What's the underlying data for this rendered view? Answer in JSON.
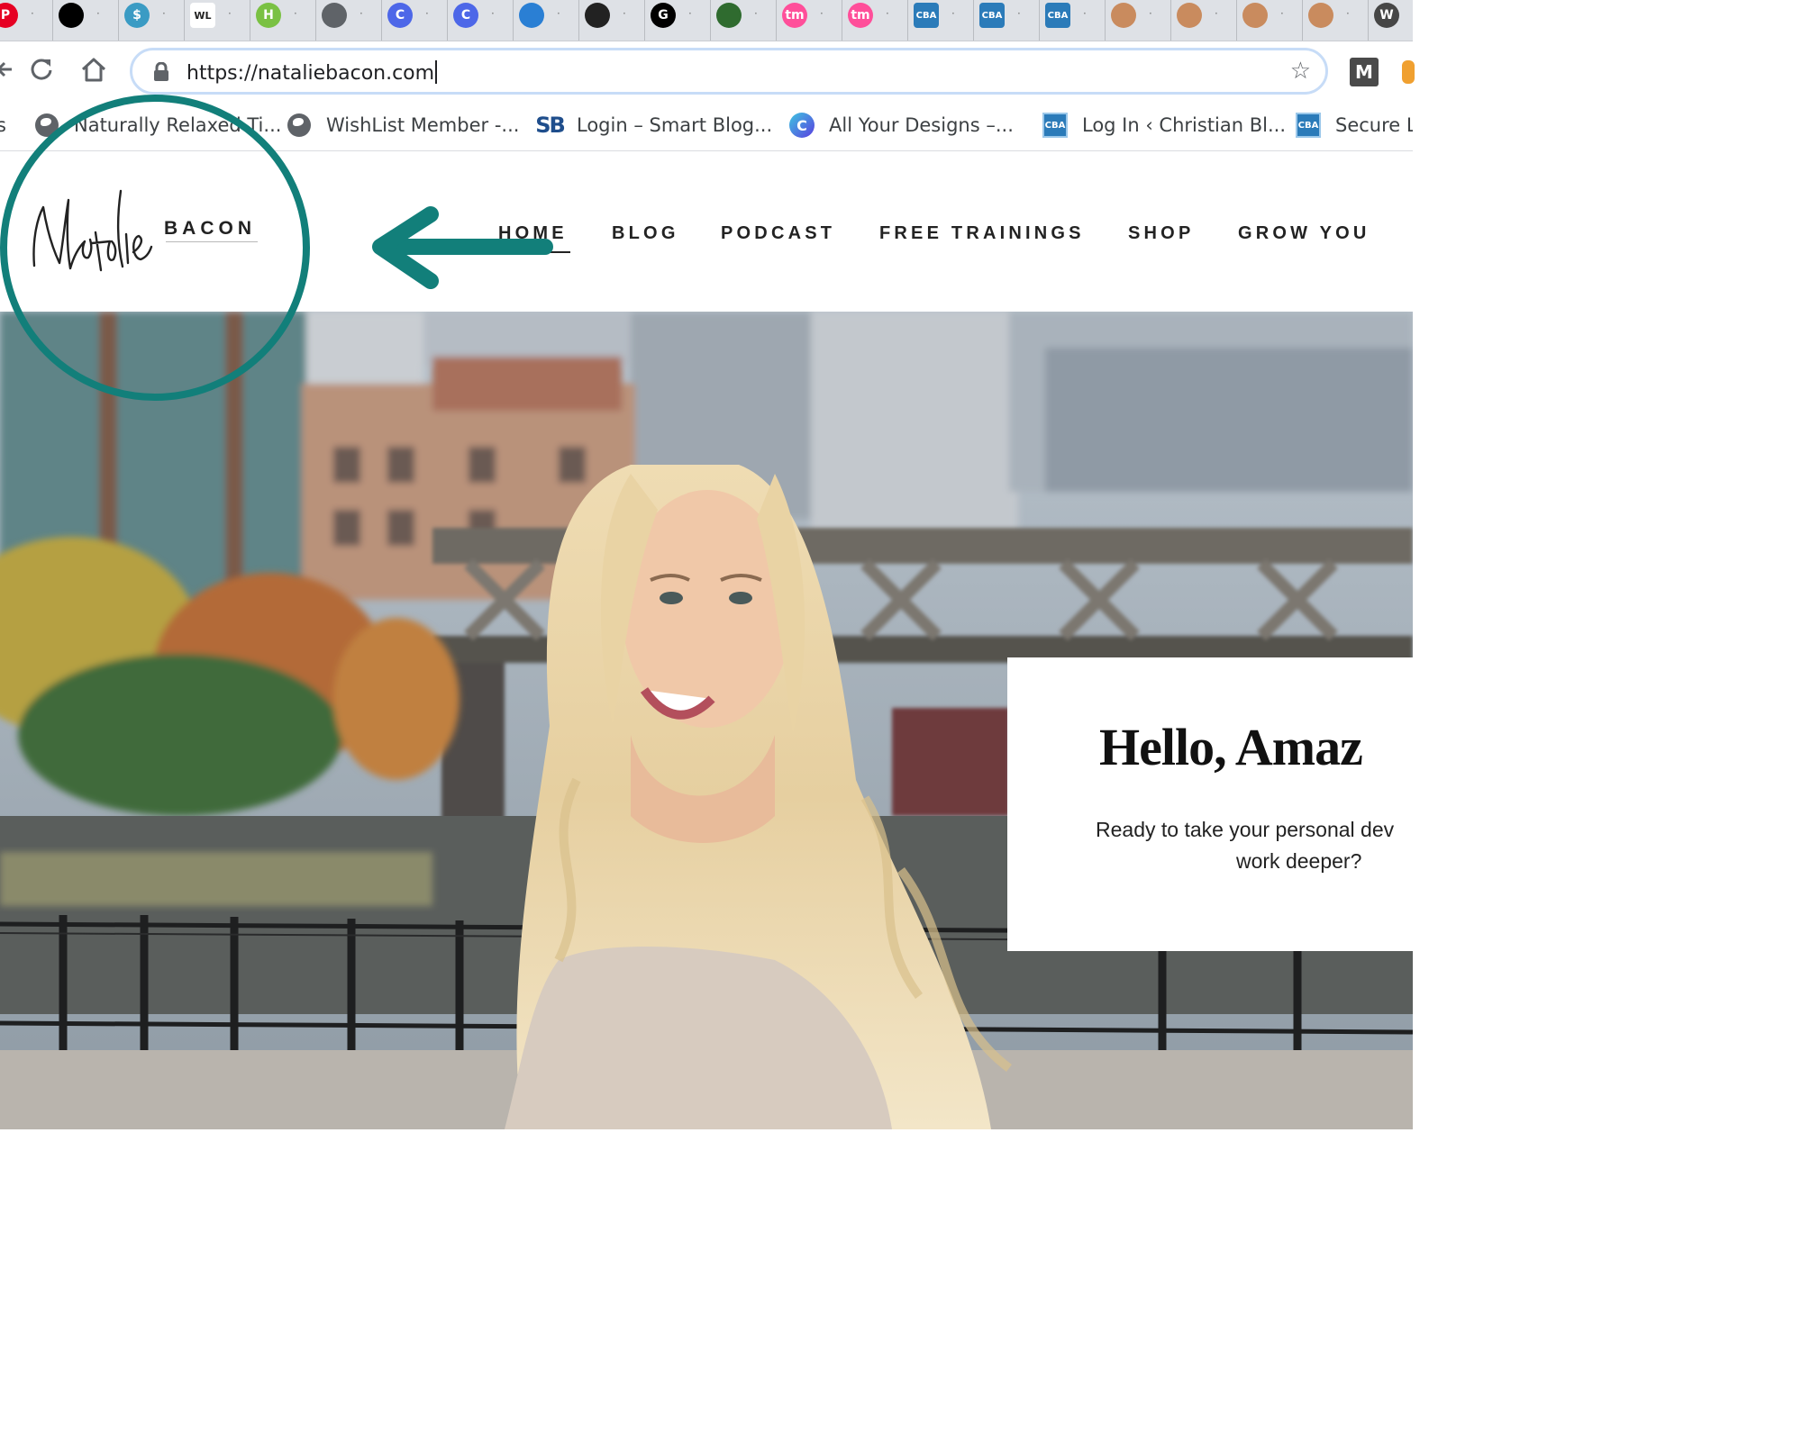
{
  "browser": {
    "tabs": [
      {
        "icon": "pinterest-icon",
        "color": "#e60023",
        "glyph": "P"
      },
      {
        "icon": "black-circle-icon",
        "color": "#000000",
        "glyph": ""
      },
      {
        "icon": "dollar-icon",
        "color": "#3a9bc4",
        "glyph": "$"
      },
      {
        "icon": "wl-icon",
        "color": "#ffffff",
        "glyph": "WL"
      },
      {
        "icon": "green-h-icon",
        "color": "#7ac143",
        "glyph": "H"
      },
      {
        "icon": "globe-icon",
        "color": "#5f6368",
        "glyph": ""
      },
      {
        "icon": "canva-icon",
        "color": "#4d67e8",
        "glyph": "C"
      },
      {
        "icon": "canva-icon",
        "color": "#4d67e8",
        "glyph": "C"
      },
      {
        "icon": "sail-icon",
        "color": "#2a7fd4",
        "glyph": ""
      },
      {
        "icon": "trello-icon",
        "color": "#222222",
        "glyph": ""
      },
      {
        "icon": "g-icon",
        "color": "#000000",
        "glyph": "G"
      },
      {
        "icon": "chart-icon",
        "color": "#2f6b2f",
        "glyph": ""
      },
      {
        "icon": "tm-icon",
        "color": "#ff4f9a",
        "glyph": "tm"
      },
      {
        "icon": "tm-icon",
        "color": "#ff4f9a",
        "glyph": "tm"
      },
      {
        "icon": "cba-icon",
        "color": "#2b7bb9",
        "glyph": "CBA"
      },
      {
        "icon": "cba-icon",
        "color": "#2b7bb9",
        "glyph": "CBA"
      },
      {
        "icon": "cba-icon",
        "color": "#2b7bb9",
        "glyph": "CBA"
      },
      {
        "icon": "avatar-icon",
        "color": "#c98b5e",
        "glyph": ""
      },
      {
        "icon": "avatar-icon",
        "color": "#c98b5e",
        "glyph": ""
      },
      {
        "icon": "avatar-icon",
        "color": "#c98b5e",
        "glyph": ""
      },
      {
        "icon": "avatar-icon",
        "color": "#c98b5e",
        "glyph": ""
      },
      {
        "icon": "wordpress-icon",
        "color": "#464646",
        "glyph": "W"
      }
    ],
    "address_bar": {
      "url": "https://nataliebacon.com"
    },
    "extension_label": "M",
    "bookmarks": [
      {
        "label": "s",
        "icon": ""
      },
      {
        "label": "Naturally Relaxed Ti...",
        "icon": "globe-icon"
      },
      {
        "label": "WishList Member -...",
        "icon": "globe-icon"
      },
      {
        "label": "Login – Smart Blog...",
        "icon": "sb-icon"
      },
      {
        "label": "All Your Designs –...",
        "icon": "canva-icon"
      },
      {
        "label": "Log In ‹ Christian Bl...",
        "icon": "cba-icon"
      },
      {
        "label": "Secure Lo",
        "icon": "cba-icon"
      }
    ]
  },
  "site": {
    "logo": {
      "script": "Natalie",
      "word": "BACON"
    },
    "nav": [
      "HOME",
      "BLOG",
      "PODCAST",
      "FREE TRAININGS",
      "SHOP",
      "GROW YOU"
    ],
    "active_nav": "HOME",
    "hero": {
      "title": "Hello, Amaz",
      "subtitle_line1": "Ready to take your personal dev",
      "subtitle_line2": "work deeper?"
    }
  },
  "annotation": {
    "color": "#127f7a",
    "shape": "circle-with-arrow"
  }
}
